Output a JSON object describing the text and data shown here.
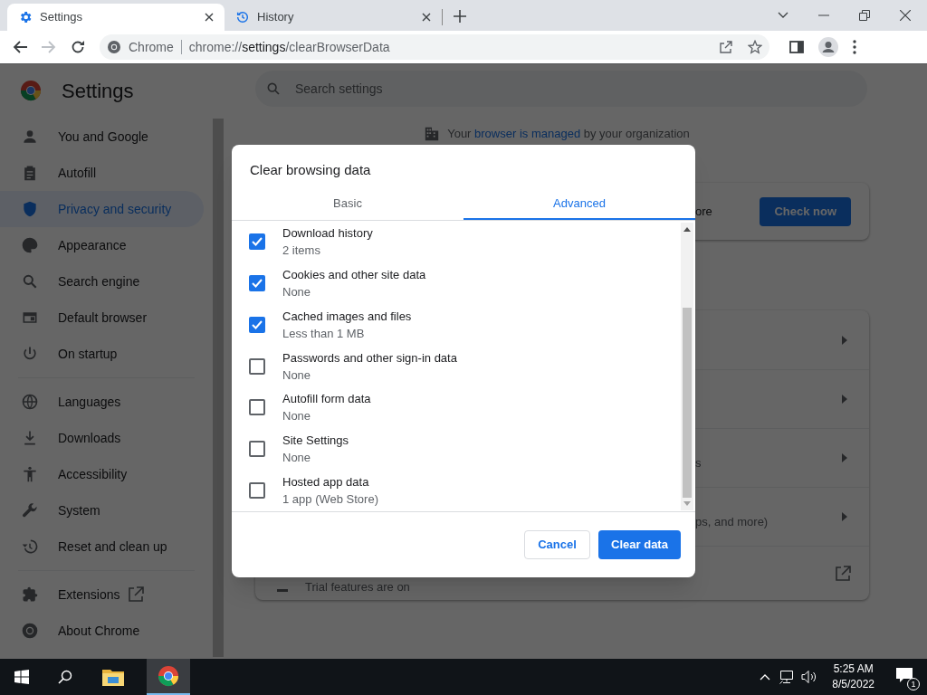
{
  "browser": {
    "tabs": [
      {
        "label": "Settings",
        "selected": true
      },
      {
        "label": "History",
        "selected": false
      }
    ],
    "omnibox": {
      "site": "Chrome",
      "url_scheme": "chrome://",
      "url_host": "settings",
      "url_path": "/clearBrowserData"
    }
  },
  "settings": {
    "title": "Settings",
    "search_placeholder": "Search settings",
    "nav": [
      {
        "label": "You and Google",
        "selected": false
      },
      {
        "label": "Autofill",
        "selected": false
      },
      {
        "label": "Privacy and security",
        "selected": true
      },
      {
        "label": "Appearance",
        "selected": false
      },
      {
        "label": "Search engine",
        "selected": false
      },
      {
        "label": "Default browser",
        "selected": false
      },
      {
        "label": "On startup",
        "selected": false
      },
      {
        "label": "Languages",
        "selected": false
      },
      {
        "label": "Downloads",
        "selected": false
      },
      {
        "label": "Accessibility",
        "selected": false
      },
      {
        "label": "System",
        "selected": false
      },
      {
        "label": "Reset and clean up",
        "selected": false
      },
      {
        "label": "Extensions",
        "selected": false
      },
      {
        "label": "About Chrome",
        "selected": false
      }
    ],
    "managed_notice": {
      "before": "Your ",
      "link": "browser is managed",
      "after": " by your organization"
    },
    "safety_card": {
      "text": "ore",
      "button": "Check now"
    },
    "privacy_rows": [
      "s",
      "ps, and more)"
    ],
    "trial_text": "Trial features are on"
  },
  "dialog": {
    "title": "Clear browsing data",
    "tabs": [
      {
        "label": "Basic",
        "selected": false
      },
      {
        "label": "Advanced",
        "selected": true
      }
    ],
    "items": [
      {
        "label": "Download history",
        "detail": "2 items",
        "checked": true
      },
      {
        "label": "Cookies and other site data",
        "detail": "None",
        "checked": true
      },
      {
        "label": "Cached images and files",
        "detail": "Less than 1 MB",
        "checked": true
      },
      {
        "label": "Passwords and other sign-in data",
        "detail": "None",
        "checked": false
      },
      {
        "label": "Autofill form data",
        "detail": "None",
        "checked": false
      },
      {
        "label": "Site Settings",
        "detail": "None",
        "checked": false
      },
      {
        "label": "Hosted app data",
        "detail": "1 app (Web Store)",
        "checked": false
      }
    ],
    "buttons": {
      "cancel": "Cancel",
      "confirm": "Clear data"
    }
  },
  "taskbar": {
    "time": "5:25 AM",
    "date": "8/5/2022",
    "notifications": "1"
  }
}
